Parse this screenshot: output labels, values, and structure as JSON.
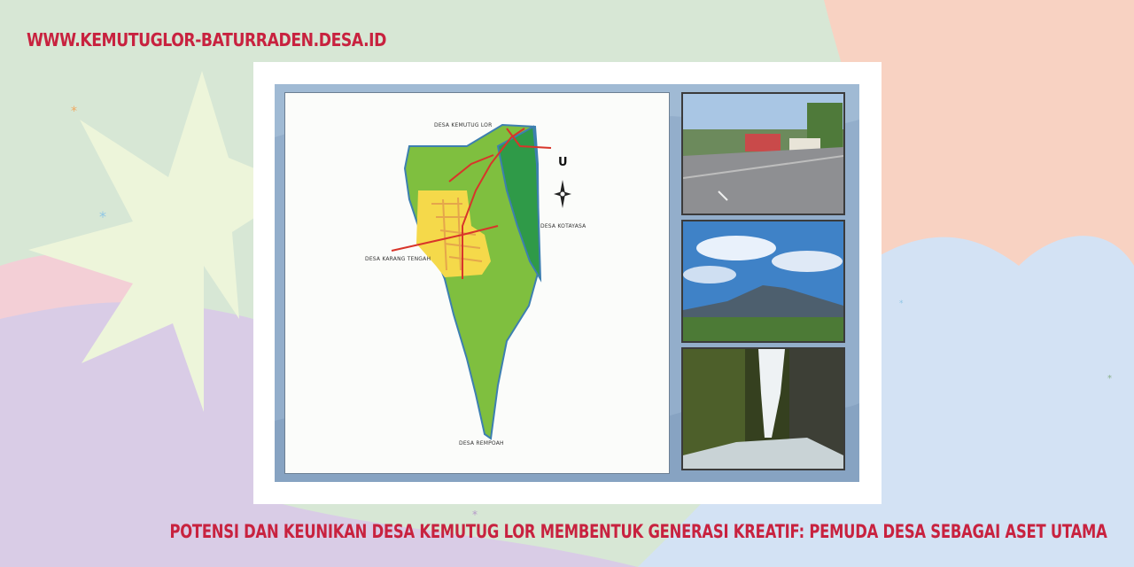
{
  "site_url": "WWW.KEMUTUGLOR-BATURRADEN.DESA.ID",
  "headline": "POTENSI DAN KEUNIKAN DESA KEMUTUG LOR MEMBENTUK GENERASI KREATIF: PEMUDA DESA SEBAGAI ASET UTAMA",
  "map": {
    "north_symbol": "U",
    "labels": {
      "north": "DESA KEMUTUG LOR",
      "east": "DESA KOTAYASA",
      "west": "DESA KARANG TENGAH",
      "south": "DESA REMPOAH"
    }
  },
  "photos": [
    {
      "subject": "village-road"
    },
    {
      "subject": "mountain-landscape"
    },
    {
      "subject": "waterfall"
    }
  ],
  "colors": {
    "accent_text": "#c8223f",
    "map_green": "#7fbf3f",
    "river_green": "#2e9a4a",
    "settlement_yellow": "#f5d94a",
    "road_red": "#d8352a"
  }
}
